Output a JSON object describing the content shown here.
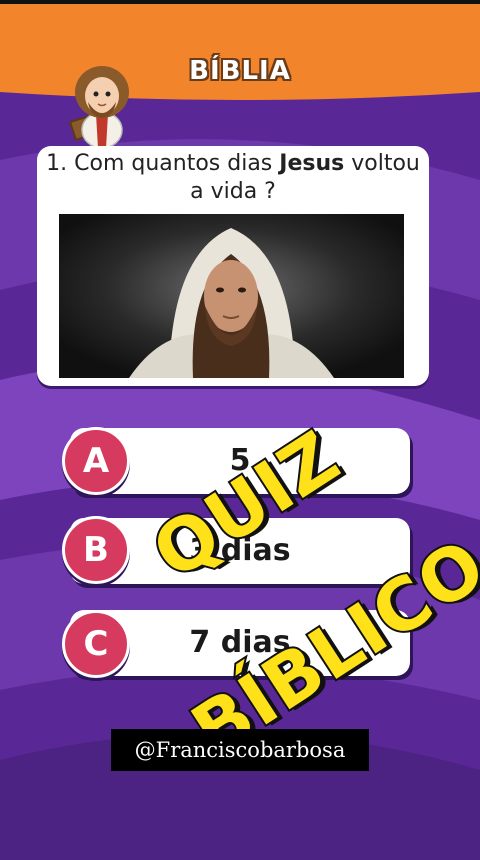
{
  "header": {
    "title": "BÍBLIA",
    "bg_color": "#f2852c"
  },
  "question": {
    "prefix": "1. Com quantos dias ",
    "highlight": "Jesus",
    "suffix": " voltou a vida ?",
    "image": "jesus-portrait"
  },
  "options": [
    {
      "letter": "A",
      "text": "5"
    },
    {
      "letter": "B",
      "text": "3 dias"
    },
    {
      "letter": "C",
      "text": "7 dias"
    }
  ],
  "stamp": {
    "text": "QUIZ BÍBLICO",
    "color": "#ffe11a"
  },
  "credit": {
    "text": "@Franciscobarbosa"
  },
  "colors": {
    "background": "#5b2a97",
    "badge": "#d63a5e"
  }
}
